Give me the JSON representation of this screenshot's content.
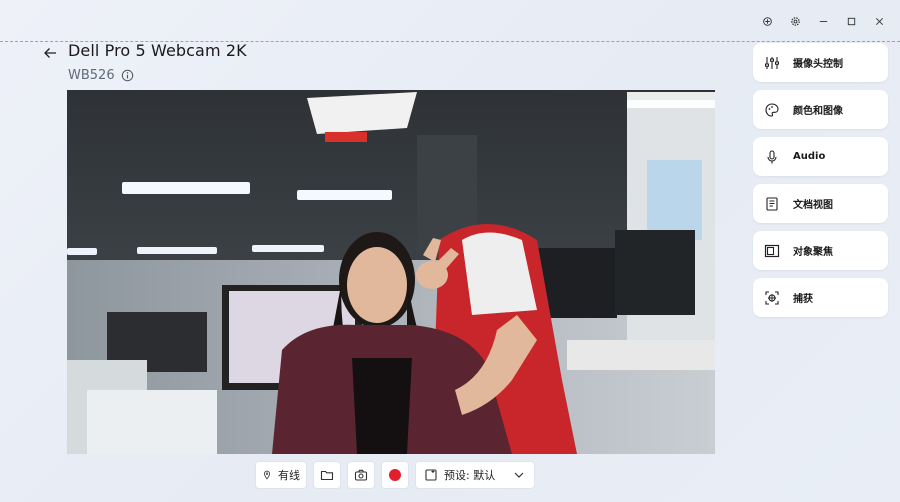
{
  "window": {
    "controls": [
      {
        "name": "pin-icon"
      },
      {
        "name": "settings-icon"
      },
      {
        "name": "minimize-icon"
      },
      {
        "name": "maximize-icon"
      },
      {
        "name": "close-icon"
      }
    ]
  },
  "header": {
    "title": "Dell Pro 5 Webcam 2K",
    "model": "WB526"
  },
  "toolbar": {
    "connection_label": "有线",
    "preset_label": "预设: 默认"
  },
  "sidebar": {
    "items": [
      {
        "label": "摄像头控制",
        "icon": "sliders-icon"
      },
      {
        "label": "颜色和图像",
        "icon": "palette-icon"
      },
      {
        "label": "Audio",
        "icon": "microphone-icon"
      },
      {
        "label": "文档视图",
        "icon": "document-icon"
      },
      {
        "label": "对象聚焦",
        "icon": "frame-icon"
      },
      {
        "label": "捕获",
        "icon": "capture-icon"
      }
    ]
  },
  "colors": {
    "accent_record": "#e2202d",
    "background": "#eef1f8",
    "panel": "#ffffff"
  }
}
